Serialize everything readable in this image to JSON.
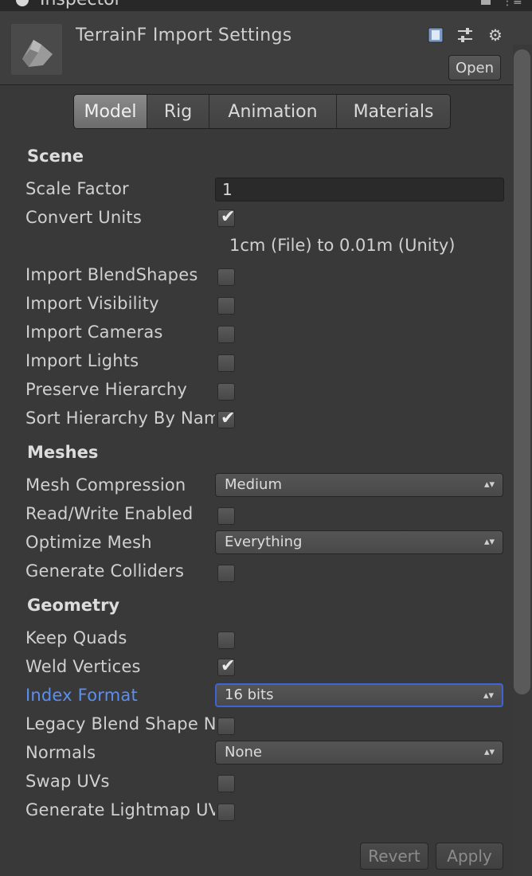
{
  "window": {
    "tab_title": "Inspector"
  },
  "header": {
    "asset_title": "TerrainF Import Settings",
    "open_label": "Open",
    "icons": [
      "book-icon",
      "sliders-icon",
      "gear-icon"
    ]
  },
  "tabs": [
    {
      "label": "Model",
      "active": true
    },
    {
      "label": "Rig",
      "active": false
    },
    {
      "label": "Animation",
      "active": false
    },
    {
      "label": "Materials",
      "active": false
    }
  ],
  "scene": {
    "heading": "Scene",
    "scale_factor_label": "Scale Factor",
    "scale_factor_value": "1",
    "convert_units_label": "Convert Units",
    "convert_units_checked": true,
    "convert_units_note": "1cm (File) to 0.01m (Unity)",
    "rows": [
      {
        "label": "Import BlendShapes",
        "checked": false
      },
      {
        "label": "Import Visibility",
        "checked": false
      },
      {
        "label": "Import Cameras",
        "checked": false
      },
      {
        "label": "Import Lights",
        "checked": false
      },
      {
        "label": "Preserve Hierarchy",
        "checked": false
      },
      {
        "label": "Sort Hierarchy By Name",
        "checked": true
      }
    ]
  },
  "meshes": {
    "heading": "Meshes",
    "mesh_compression_label": "Mesh Compression",
    "mesh_compression_value": "Medium",
    "read_write_label": "Read/Write Enabled",
    "read_write_checked": false,
    "optimize_mesh_label": "Optimize Mesh",
    "optimize_mesh_value": "Everything",
    "generate_colliders_label": "Generate Colliders",
    "generate_colliders_checked": false
  },
  "geometry": {
    "heading": "Geometry",
    "keep_quads_label": "Keep Quads",
    "keep_quads_checked": false,
    "weld_vertices_label": "Weld Vertices",
    "weld_vertices_checked": true,
    "index_format_label": "Index Format",
    "index_format_value": "16 bits",
    "legacy_blend_label": "Legacy Blend Shape Normals",
    "legacy_blend_checked": false,
    "normals_label": "Normals",
    "normals_value": "None",
    "swap_uvs_label": "Swap UVs",
    "swap_uvs_checked": false,
    "generate_lightmap_label": "Generate Lightmap UVs",
    "generate_lightmap_checked": false
  },
  "footer": {
    "revert_label": "Revert",
    "apply_label": "Apply"
  },
  "colors": {
    "focus": "#5a8ff2",
    "focus_border": "#3f62d6",
    "panel": "#393939"
  }
}
